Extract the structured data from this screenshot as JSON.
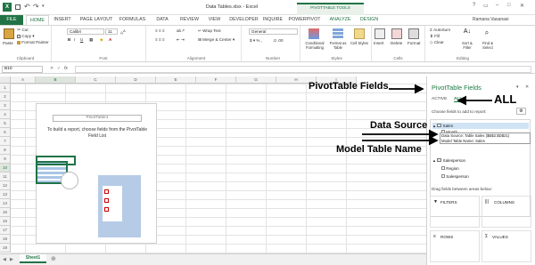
{
  "window": {
    "title": "Data Tables.xlsx - Excel",
    "user": "Ramana Vasanasi"
  },
  "context_tab_group": "PIVOTTABLE TOOLS",
  "ribbon_tabs": [
    {
      "label": "FILE",
      "active": false,
      "file": true
    },
    {
      "label": "HOME",
      "active": true
    },
    {
      "label": "INSERT"
    },
    {
      "label": "PAGE LAYOUT"
    },
    {
      "label": "FORMULAS"
    },
    {
      "label": "DATA"
    },
    {
      "label": "REVIEW"
    },
    {
      "label": "VIEW"
    },
    {
      "label": "DEVELOPER"
    },
    {
      "label": "INQUIRE"
    },
    {
      "label": "POWERPIVOT"
    },
    {
      "label": "ANALYZE"
    },
    {
      "label": "DESIGN"
    }
  ],
  "ribbon": {
    "clipboard": {
      "paste": "Paste",
      "cut": "Cut",
      "copy": "Copy",
      "format_painter": "Format Painter",
      "label": "Clipboard"
    },
    "font": {
      "name": "Calibri",
      "size": "11",
      "label": "Font"
    },
    "alignment": {
      "wrap": "Wrap Text",
      "merge": "Merge & Center",
      "label": "Alignment"
    },
    "number": {
      "format": "General",
      "label": "Number"
    },
    "styles": {
      "conditional": "Conditional Formatting",
      "format_table": "Format as Table",
      "cell_styles": "Cell Styles",
      "label": "Styles"
    },
    "cells": {
      "insert": "Insert",
      "delete": "Delete",
      "format": "Format",
      "label": "Cells"
    },
    "editing": {
      "autosum": "AutoSum",
      "fill": "Fill",
      "clear": "Clear",
      "sort": "Sort & Filter",
      "find": "Find & Select",
      "label": "Editing"
    }
  },
  "formula_bar": {
    "name_box": "B10",
    "fx": "fx",
    "content": ""
  },
  "columns": [
    "A",
    "B",
    "C",
    "D",
    "E",
    "F",
    "G",
    "H",
    "I"
  ],
  "rows": [
    "1",
    "2",
    "3",
    "4",
    "5",
    "6",
    "7",
    "8",
    "9",
    "10",
    "11",
    "12",
    "13",
    "14",
    "15",
    "16",
    "17",
    "18",
    "19"
  ],
  "pivot_placeholder": {
    "title": "PivotTable1",
    "message": "To build a report, choose fields from the PivotTable Field List"
  },
  "sheet_tabs": [
    {
      "label": "Sheet1",
      "active": true
    }
  ],
  "panel": {
    "title": "PivotTable Fields",
    "tab_active": "ACTIVE",
    "tab_all": "ALL",
    "choose_label": "Choose fields to add to report:",
    "fields": [
      {
        "label": "Sales",
        "checked": false,
        "highlight": true
      },
      {
        "label": "Month",
        "checked": false,
        "sub": true
      }
    ],
    "tooltip": [
      "Data Source: Table Sales ($B$2:$D$21)",
      "Model Table Name: Sales"
    ],
    "salesperson_table": "Salesperson",
    "salesperson_fields": [
      "Region",
      "Salesperson"
    ],
    "drag_label": "Drag fields between areas below:",
    "areas": {
      "filters": "FILTERS",
      "columns": "COLUMNS",
      "rows": "ROWS",
      "values": "VALUES"
    }
  },
  "annotations": {
    "pivot_fields": "PivotTable Fields",
    "all": "ALL",
    "data_source": "Data Source",
    "model_table": "Model Table Name"
  },
  "colors": {
    "excel_green": "#217346",
    "pivot_green": "#1e7b45",
    "arrow": "#000000"
  }
}
